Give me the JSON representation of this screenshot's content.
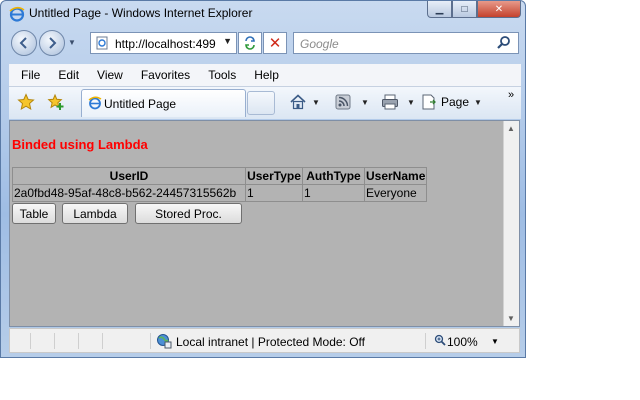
{
  "window": {
    "title": "Untitled Page - Windows Internet Explorer",
    "minimize_glyph": "▁",
    "maximize_glyph": "□",
    "close_glyph": "✕"
  },
  "navigation": {
    "address": "http://localhost:499",
    "search_placeholder": "Google"
  },
  "menu": {
    "items": [
      "File",
      "Edit",
      "View",
      "Favorites",
      "Tools",
      "Help"
    ]
  },
  "tabs": {
    "active_label": "Untitled Page"
  },
  "command_bar": {
    "page_label": "Page",
    "overflow": "»"
  },
  "page": {
    "heading": "Binded using Lambda",
    "heading_color": "#ff0000",
    "grid": {
      "columns": [
        "UserID",
        "UserType",
        "AuthType",
        "UserName"
      ],
      "rows": [
        [
          "2a0fbd48-95af-48c8-b562-24457315562b",
          "1",
          "1",
          "Everyone"
        ]
      ]
    },
    "buttons": {
      "table": "Table",
      "lambda": "Lambda",
      "stored_proc": "Stored Proc."
    }
  },
  "status": {
    "zone": "Local intranet | Protected Mode: Off",
    "zoom": "100%"
  },
  "icons": [
    "ie-icon",
    "back-arrow-icon",
    "forward-arrow-icon",
    "refresh-icon",
    "stop-icon",
    "search-icon",
    "favorites-star-icon",
    "add-favorites-icon",
    "home-icon",
    "feeds-icon",
    "print-icon",
    "page-icon",
    "intranet-zone-icon",
    "zoom-icon"
  ]
}
